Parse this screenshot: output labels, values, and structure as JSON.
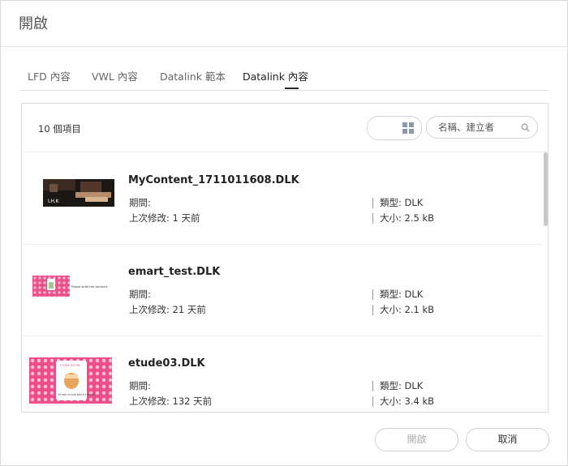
{
  "dialog": {
    "title": "開啟"
  },
  "tabs": [
    {
      "label": "LFD 內容"
    },
    {
      "label": "VWL 內容"
    },
    {
      "label": "Datalink 範本"
    },
    {
      "label": "Datalink 內容"
    }
  ],
  "toolbar": {
    "count": "10 個項目",
    "search_placeholder": "名稱、建立者",
    "view_active": "list"
  },
  "items": [
    {
      "name": "MyContent_1711011608.DLK",
      "period_label": "期間:",
      "modified": "上次修改: 1 天前",
      "type": "類型: DLK",
      "size": "大小: 2.5 kB"
    },
    {
      "name": "emart_test.DLK",
      "period_label": "期間:",
      "modified": "上次修改: 21 天前",
      "type": "類型: DLK",
      "size": "大小: 2.1 kB"
    },
    {
      "name": "etude03.DLK",
      "period_label": "期間:",
      "modified": "上次修改: 132 天前",
      "type": "類型: DLK",
      "size": "大小: 3.4 kB"
    }
  ],
  "thumb_text": {
    "thumb1": "LH.K",
    "thumb2": "Please write the contents",
    "thumb3_top": "ETUDE HOUSE",
    "thumb3_bottom": "ETUDE HOUSE BEAUTY EVENT"
  },
  "footer": {
    "open_label": "開啟",
    "cancel_label": "取消"
  },
  "colors": {
    "accent": "#7d8ea5",
    "pink": "#ee4f8a"
  }
}
